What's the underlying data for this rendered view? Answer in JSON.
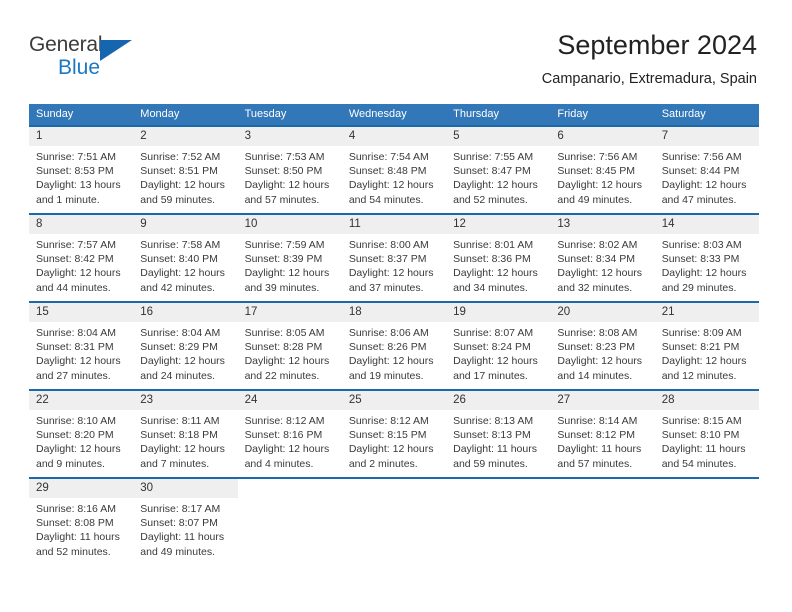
{
  "brand": {
    "name_top": "General",
    "name_bottom": "Blue",
    "accent_color": "#1b79c4",
    "triangle_color": "#1566ae"
  },
  "header": {
    "title": "September 2024",
    "subtitle": "Campanario, Extremadura, Spain"
  },
  "theme": {
    "header_bar_color": "#3277b8",
    "row_rule_color": "#1b69ab",
    "daynum_band_color": "#efefef",
    "text_color": "#3a3a3a"
  },
  "weekdays": [
    "Sunday",
    "Monday",
    "Tuesday",
    "Wednesday",
    "Thursday",
    "Friday",
    "Saturday"
  ],
  "weeks": [
    {
      "leading_blanks": 0,
      "days": [
        {
          "day": "1",
          "sunrise": "Sunrise: 7:51 AM",
          "sunset": "Sunset: 8:53 PM",
          "daylight": "Daylight: 13 hours and 1 minute."
        },
        {
          "day": "2",
          "sunrise": "Sunrise: 7:52 AM",
          "sunset": "Sunset: 8:51 PM",
          "daylight": "Daylight: 12 hours and 59 minutes."
        },
        {
          "day": "3",
          "sunrise": "Sunrise: 7:53 AM",
          "sunset": "Sunset: 8:50 PM",
          "daylight": "Daylight: 12 hours and 57 minutes."
        },
        {
          "day": "4",
          "sunrise": "Sunrise: 7:54 AM",
          "sunset": "Sunset: 8:48 PM",
          "daylight": "Daylight: 12 hours and 54 minutes."
        },
        {
          "day": "5",
          "sunrise": "Sunrise: 7:55 AM",
          "sunset": "Sunset: 8:47 PM",
          "daylight": "Daylight: 12 hours and 52 minutes."
        },
        {
          "day": "6",
          "sunrise": "Sunrise: 7:56 AM",
          "sunset": "Sunset: 8:45 PM",
          "daylight": "Daylight: 12 hours and 49 minutes."
        },
        {
          "day": "7",
          "sunrise": "Sunrise: 7:56 AM",
          "sunset": "Sunset: 8:44 PM",
          "daylight": "Daylight: 12 hours and 47 minutes."
        }
      ]
    },
    {
      "leading_blanks": 0,
      "days": [
        {
          "day": "8",
          "sunrise": "Sunrise: 7:57 AM",
          "sunset": "Sunset: 8:42 PM",
          "daylight": "Daylight: 12 hours and 44 minutes."
        },
        {
          "day": "9",
          "sunrise": "Sunrise: 7:58 AM",
          "sunset": "Sunset: 8:40 PM",
          "daylight": "Daylight: 12 hours and 42 minutes."
        },
        {
          "day": "10",
          "sunrise": "Sunrise: 7:59 AM",
          "sunset": "Sunset: 8:39 PM",
          "daylight": "Daylight: 12 hours and 39 minutes."
        },
        {
          "day": "11",
          "sunrise": "Sunrise: 8:00 AM",
          "sunset": "Sunset: 8:37 PM",
          "daylight": "Daylight: 12 hours and 37 minutes."
        },
        {
          "day": "12",
          "sunrise": "Sunrise: 8:01 AM",
          "sunset": "Sunset: 8:36 PM",
          "daylight": "Daylight: 12 hours and 34 minutes."
        },
        {
          "day": "13",
          "sunrise": "Sunrise: 8:02 AM",
          "sunset": "Sunset: 8:34 PM",
          "daylight": "Daylight: 12 hours and 32 minutes."
        },
        {
          "day": "14",
          "sunrise": "Sunrise: 8:03 AM",
          "sunset": "Sunset: 8:33 PM",
          "daylight": "Daylight: 12 hours and 29 minutes."
        }
      ]
    },
    {
      "leading_blanks": 0,
      "days": [
        {
          "day": "15",
          "sunrise": "Sunrise: 8:04 AM",
          "sunset": "Sunset: 8:31 PM",
          "daylight": "Daylight: 12 hours and 27 minutes."
        },
        {
          "day": "16",
          "sunrise": "Sunrise: 8:04 AM",
          "sunset": "Sunset: 8:29 PM",
          "daylight": "Daylight: 12 hours and 24 minutes."
        },
        {
          "day": "17",
          "sunrise": "Sunrise: 8:05 AM",
          "sunset": "Sunset: 8:28 PM",
          "daylight": "Daylight: 12 hours and 22 minutes."
        },
        {
          "day": "18",
          "sunrise": "Sunrise: 8:06 AM",
          "sunset": "Sunset: 8:26 PM",
          "daylight": "Daylight: 12 hours and 19 minutes."
        },
        {
          "day": "19",
          "sunrise": "Sunrise: 8:07 AM",
          "sunset": "Sunset: 8:24 PM",
          "daylight": "Daylight: 12 hours and 17 minutes."
        },
        {
          "day": "20",
          "sunrise": "Sunrise: 8:08 AM",
          "sunset": "Sunset: 8:23 PM",
          "daylight": "Daylight: 12 hours and 14 minutes."
        },
        {
          "day": "21",
          "sunrise": "Sunrise: 8:09 AM",
          "sunset": "Sunset: 8:21 PM",
          "daylight": "Daylight: 12 hours and 12 minutes."
        }
      ]
    },
    {
      "leading_blanks": 0,
      "days": [
        {
          "day": "22",
          "sunrise": "Sunrise: 8:10 AM",
          "sunset": "Sunset: 8:20 PM",
          "daylight": "Daylight: 12 hours and 9 minutes."
        },
        {
          "day": "23",
          "sunrise": "Sunrise: 8:11 AM",
          "sunset": "Sunset: 8:18 PM",
          "daylight": "Daylight: 12 hours and 7 minutes."
        },
        {
          "day": "24",
          "sunrise": "Sunrise: 8:12 AM",
          "sunset": "Sunset: 8:16 PM",
          "daylight": "Daylight: 12 hours and 4 minutes."
        },
        {
          "day": "25",
          "sunrise": "Sunrise: 8:12 AM",
          "sunset": "Sunset: 8:15 PM",
          "daylight": "Daylight: 12 hours and 2 minutes."
        },
        {
          "day": "26",
          "sunrise": "Sunrise: 8:13 AM",
          "sunset": "Sunset: 8:13 PM",
          "daylight": "Daylight: 11 hours and 59 minutes."
        },
        {
          "day": "27",
          "sunrise": "Sunrise: 8:14 AM",
          "sunset": "Sunset: 8:12 PM",
          "daylight": "Daylight: 11 hours and 57 minutes."
        },
        {
          "day": "28",
          "sunrise": "Sunrise: 8:15 AM",
          "sunset": "Sunset: 8:10 PM",
          "daylight": "Daylight: 11 hours and 54 minutes."
        }
      ]
    },
    {
      "leading_blanks": 0,
      "days": [
        {
          "day": "29",
          "sunrise": "Sunrise: 8:16 AM",
          "sunset": "Sunset: 8:08 PM",
          "daylight": "Daylight: 11 hours and 52 minutes."
        },
        {
          "day": "30",
          "sunrise": "Sunrise: 8:17 AM",
          "sunset": "Sunset: 8:07 PM",
          "daylight": "Daylight: 11 hours and 49 minutes."
        }
      ]
    }
  ]
}
